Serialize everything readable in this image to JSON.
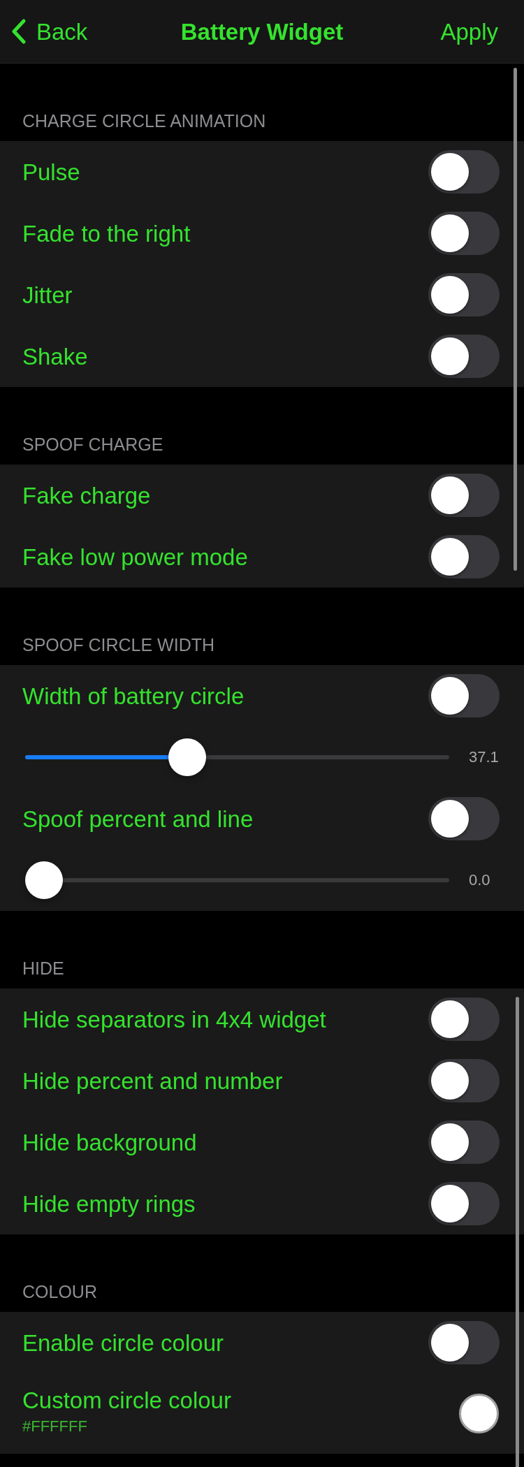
{
  "header": {
    "back": "Back",
    "title": "Battery Widget",
    "action": "Apply"
  },
  "sections": [
    {
      "title": "CHARGE CIRCLE ANIMATION",
      "rows": [
        {
          "kind": "toggle",
          "label": "Pulse",
          "on": false
        },
        {
          "kind": "toggle",
          "label": "Fade to the right",
          "on": false
        },
        {
          "kind": "toggle",
          "label": "Jitter",
          "on": false
        },
        {
          "kind": "toggle",
          "label": "Shake",
          "on": false
        }
      ]
    },
    {
      "title": "SPOOF CHARGE",
      "rows": [
        {
          "kind": "toggle",
          "label": "Fake charge",
          "on": false
        },
        {
          "kind": "toggle",
          "label": "Fake low power mode",
          "on": false
        }
      ]
    },
    {
      "title": "SPOOF CIRCLE WIDTH",
      "rows": [
        {
          "kind": "toggle",
          "label": "Width of battery circle",
          "on": false
        },
        {
          "kind": "slider",
          "level": 0.371,
          "reading": "37.1"
        },
        {
          "kind": "toggle",
          "label": "Spoof percent and line",
          "on": false
        },
        {
          "kind": "slider",
          "level": 0,
          "reading": "0.0"
        }
      ]
    },
    {
      "title": "HIDE",
      "rows": [
        {
          "kind": "toggle",
          "label": "Hide separators in 4x4 widget",
          "on": false
        },
        {
          "kind": "toggle",
          "label": "Hide percent and number",
          "on": false
        },
        {
          "kind": "toggle",
          "label": "Hide background",
          "on": false
        },
        {
          "kind": "toggle",
          "label": "Hide empty rings",
          "on": false
        }
      ]
    },
    {
      "title": "COLOUR",
      "rows": [
        {
          "kind": "toggle",
          "label": "Enable circle colour",
          "on": false
        },
        {
          "kind": "color",
          "label": "Custom circle colour",
          "value": "#FFFFFF",
          "color": "#ffffff"
        }
      ]
    }
  ]
}
